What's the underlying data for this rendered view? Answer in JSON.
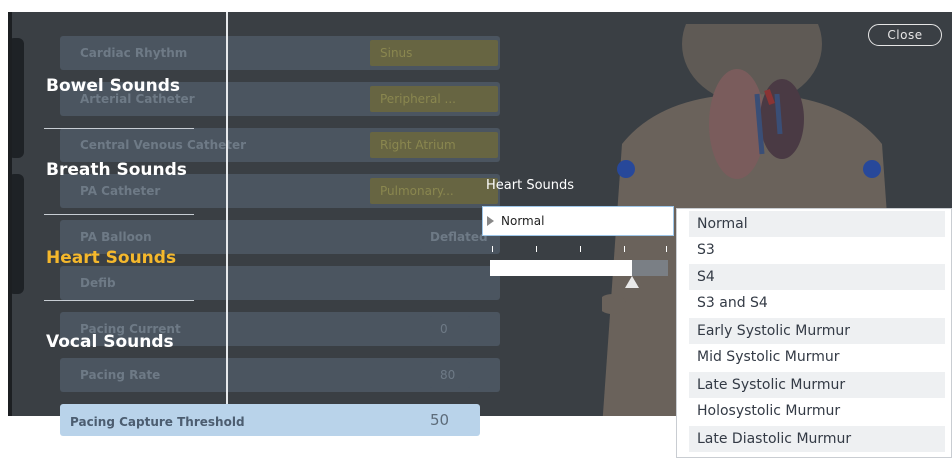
{
  "window": {
    "close_label": "Close"
  },
  "background_params": [
    {
      "name": "Cardiac Rhythm",
      "value": "Sinus"
    },
    {
      "name": "Arterial Catheter",
      "value": "Peripheral ..."
    },
    {
      "name": "Central Venous Catheter",
      "value": "Right Atrium"
    },
    {
      "name": "PA Catheter",
      "value": "Pulmonary..."
    },
    {
      "name": "PA Balloon",
      "value": "Deflated"
    },
    {
      "name": "Defib",
      "value": ""
    },
    {
      "name": "Pacing Current",
      "value": "0"
    },
    {
      "name": "Pacing Rate",
      "value": "80"
    },
    {
      "name": "Pacing Capture Threshold",
      "value": "50"
    }
  ],
  "categories": [
    {
      "label": "Bowel Sounds",
      "active": false
    },
    {
      "label": "Breath Sounds",
      "active": false
    },
    {
      "label": "Heart Sounds",
      "active": true
    },
    {
      "label": "Vocal Sounds",
      "active": false
    }
  ],
  "heart_sounds": {
    "title": "Heart Sounds",
    "selected": "Normal",
    "volume_fraction": 0.8
  },
  "dropdown": {
    "options": [
      "Normal",
      "S3",
      "S4",
      "S3 and S4",
      "Early Systolic Murmur",
      "Mid Systolic Murmur",
      "Late Systolic Murmur",
      "Holosystolic Murmur",
      "Late Diastolic Murmur"
    ]
  },
  "colors": {
    "accent": "#f5b82c",
    "overlay": "#3a3f44",
    "highlight": "#b9d3ea"
  }
}
